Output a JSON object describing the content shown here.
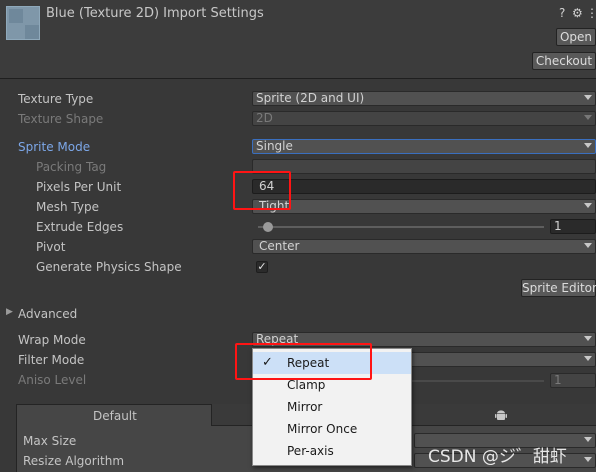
{
  "header": {
    "title": "Blue (Texture 2D) Import Settings",
    "open_label": "Open",
    "checkout_label": "Checkout",
    "help_glyph": "?",
    "settings_glyph": "⚙",
    "menu_glyph": "⋮"
  },
  "fields": {
    "texture_type": {
      "label": "Texture Type",
      "value": "Sprite (2D and UI)"
    },
    "texture_shape": {
      "label": "Texture Shape",
      "value": "2D"
    },
    "sprite_mode": {
      "label": "Sprite Mode",
      "value": "Single"
    },
    "packing_tag": {
      "label": "Packing Tag",
      "value": ""
    },
    "pixels_per_unit": {
      "label": "Pixels Per Unit",
      "value": "64"
    },
    "mesh_type": {
      "label": "Mesh Type",
      "value": "Tight"
    },
    "extrude_edges": {
      "label": "Extrude Edges",
      "value": "1"
    },
    "pivot": {
      "label": "Pivot",
      "value": "Center"
    },
    "generate_physics_shape": {
      "label": "Generate Physics Shape",
      "checked": true,
      "check_glyph": "✓"
    }
  },
  "sprite_editor_label": "Sprite Editor",
  "advanced": {
    "label": "Advanced",
    "arrow": "▶"
  },
  "wrap_mode": {
    "label": "Wrap Mode",
    "value": "Repeat"
  },
  "filter_mode": {
    "label": "Filter Mode",
    "value": ""
  },
  "aniso_level": {
    "label": "Aniso Level",
    "value": "1"
  },
  "platform_tabs": {
    "default_label": "Default",
    "android_icon": "android-icon"
  },
  "max_size": {
    "label": "Max Size"
  },
  "resize_algorithm": {
    "label": "Resize Algorithm"
  },
  "wrap_mode_popup": {
    "selected_index": 0,
    "check_glyph": "✓",
    "options": [
      "Repeat",
      "Clamp",
      "Mirror",
      "Mirror Once",
      "Per-axis"
    ]
  },
  "watermark": "CSDN @ジ゛甜虾",
  "colors": {
    "background": "#383838",
    "header": "#3c3c3c",
    "highlight_label": "#7ca7e8",
    "annotation_red": "#ff1414",
    "popup_selection": "#cce0f7"
  }
}
